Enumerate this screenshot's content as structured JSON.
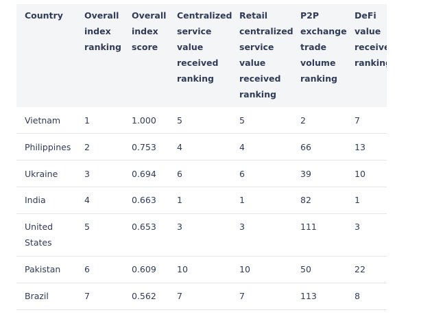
{
  "table": {
    "headers": [
      "Country",
      "Overall index ranking",
      "Overall index score",
      "Centralized service value received ranking",
      "Retail centralized service value received ranking",
      "P2P exchange trade volume ranking",
      "DeFi value received ranking"
    ],
    "rows": [
      [
        "Vietnam",
        "1",
        "1.000",
        "5",
        "5",
        "2",
        "7"
      ],
      [
        "Philippines",
        "2",
        "0.753",
        "4",
        "4",
        "66",
        "13"
      ],
      [
        "Ukraine",
        "3",
        "0.694",
        "6",
        "6",
        "39",
        "10"
      ],
      [
        "India",
        "4",
        "0.663",
        "1",
        "1",
        "82",
        "1"
      ],
      [
        "United States",
        "5",
        "0.653",
        "3",
        "3",
        "111",
        "3"
      ],
      [
        "Pakistan",
        "6",
        "0.609",
        "10",
        "10",
        "50",
        "22"
      ],
      [
        "Brazil",
        "7",
        "0.562",
        "7",
        "7",
        "113",
        "8"
      ]
    ]
  }
}
